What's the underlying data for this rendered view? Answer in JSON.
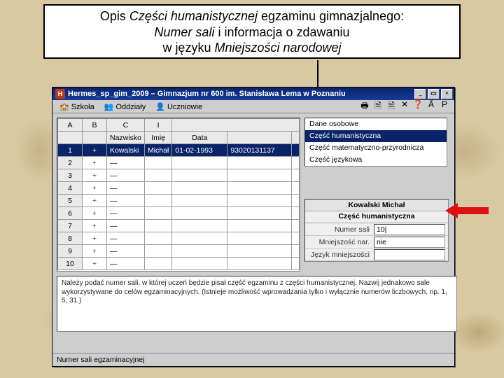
{
  "header": {
    "line1_pre": "Opis ",
    "line1_em": "Części humanistycznej",
    "line1_post": " egzaminu gimnazjalnego:",
    "line2_em": "Numer sali",
    "line2_post": " i informacja o zdawaniu",
    "line3_pre": "w języku ",
    "line3_em": "Mniejszości narodowej"
  },
  "window": {
    "title": "Hermes_sp_gim_2009 – Gimnazjum nr 600 im. Stanisława Lema w Poznaniu",
    "btn_min": "_",
    "btn_max": "▭",
    "btn_close": "×"
  },
  "menu": {
    "szkola": "Szkoła",
    "oddzialy": "Oddziały",
    "uczniowie": "Uczniowie",
    "tool_icons": [
      "🖶",
      "🗎",
      "🗎",
      "✕",
      "❓",
      "Ä",
      "P"
    ]
  },
  "table": {
    "letters": [
      "A",
      "B",
      "C",
      "I"
    ],
    "headers": [
      "",
      "",
      "Nazwisko",
      "Imię",
      "Data",
      "",
      ""
    ],
    "col_nazwisko": "Nazwisko",
    "col_imie": "Imię",
    "col_data": "Data",
    "rows": [
      {
        "n": "1",
        "nazwisko": "Kowalski",
        "imie": "Michał",
        "data": "01-02-1993",
        "pesel": "93020131137",
        "sel": true
      },
      {
        "n": "2"
      },
      {
        "n": "3"
      },
      {
        "n": "4"
      },
      {
        "n": "5"
      },
      {
        "n": "6"
      },
      {
        "n": "7"
      },
      {
        "n": "8"
      },
      {
        "n": "9"
      },
      {
        "n": "10"
      }
    ]
  },
  "side": {
    "items": [
      {
        "label": "Dane osobowe"
      },
      {
        "label": "Część humanistyczna",
        "sel": true
      },
      {
        "label": "Część matematyczno-przyrodnicza"
      },
      {
        "label": "Część językowa"
      }
    ]
  },
  "detail": {
    "name": "Kowalski Michał",
    "section": "Część humanistyczna",
    "rows": [
      {
        "label": "Numer sali",
        "value": "10|"
      },
      {
        "label": "Mniejszość nar.",
        "value": "nie"
      },
      {
        "label": "Język mniejszości",
        "value": ""
      }
    ]
  },
  "note": "Należy podać numer sali, w której uczeń będzie pisał część egzaminu z części humanistycznej. Nazwij jednakowo sale wykorzystywane do celów egzaminacyjnych. (Istnieje możliwość wprowadzania tylko i wyłącznie numerów liczbowych, np. 1, 5, 31.)",
  "status": "Numer sali egzaminacyjnej"
}
